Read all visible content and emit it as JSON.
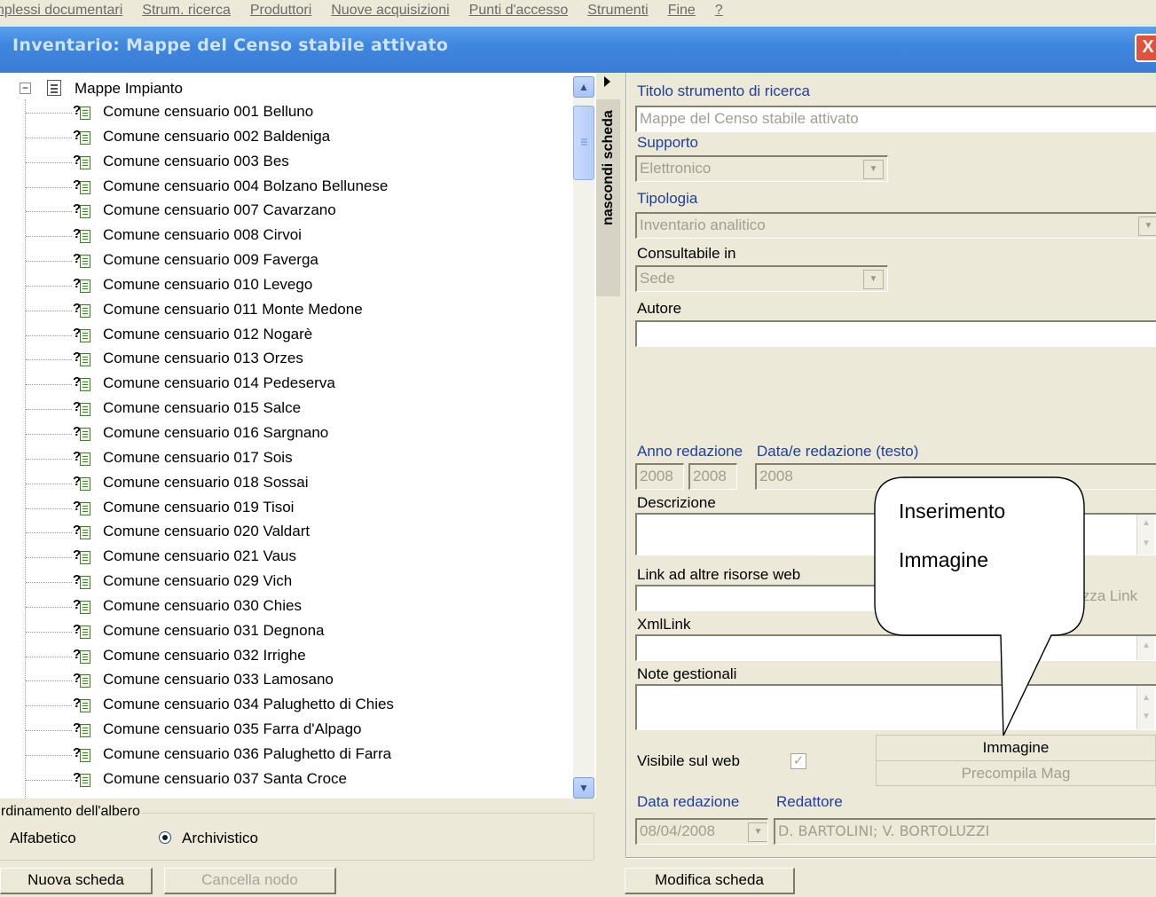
{
  "menubar": {
    "items": [
      "nplessi documentari",
      "Strum. ricerca",
      "Produttori",
      "Nuove acquisizioni",
      "Punti d'accesso",
      "Strumenti",
      "Fine",
      "?"
    ]
  },
  "window": {
    "title": "Inventario: Mappe del Censo stabile attivato",
    "close_label": "X"
  },
  "tree": {
    "root_label": "Mappe Impianto",
    "expander": "−",
    "items": [
      "Comune censuario 001 Belluno",
      "Comune censuario 002 Baldeniga",
      "Comune censuario 003 Bes",
      "Comune censuario 004 Bolzano Bellunese",
      "Comune censuario 007 Cavarzano",
      "Comune censuario 008 Cirvoi",
      "Comune censuario 009 Faverga",
      "Comune censuario 010 Levego",
      "Comune censuario 011 Monte Medone",
      "Comune censuario 012 Nogarè",
      "Comune censuario 013 Orzes",
      "Comune censuario 014 Pedeserva",
      "Comune censuario 015 Salce",
      "Comune censuario 016 Sargnano",
      "Comune censuario 017 Sois",
      "Comune censuario 018 Sossai",
      "Comune censuario 019 Tisoi",
      "Comune censuario 020 Valdart",
      "Comune censuario 021 Vaus",
      "Comune censuario 029 Vich",
      "Comune censuario 030 Chies",
      "Comune censuario 031 Degnona",
      "Comune censuario 032 Irrighe",
      "Comune censuario 033 Lamosano",
      "Comune censuario 034 Palughetto di Chies",
      "Comune censuario 035 Farra d'Alpago",
      "Comune censuario 036 Palughetto di Farra",
      "Comune censuario 037 Santa Croce"
    ],
    "node_icon": "question-document-icon"
  },
  "splitter": {
    "label": "nascondi scheda"
  },
  "ordering": {
    "legend": "rdinamento dell'albero",
    "option_alpha": "Alfabetico",
    "option_archive": "Archivistico",
    "selected": "Archivistico"
  },
  "buttons": {
    "new_card": "Nuova scheda",
    "delete_node": "Cancella nodo",
    "edit_card": "Modifica scheda",
    "image": "Immagine",
    "precompile_mag": "Precompila Mag",
    "view_link": "izza Link"
  },
  "form": {
    "titolo_label": "Titolo strumento di ricerca",
    "titolo_value": "Mappe del Censo stabile attivato",
    "supporto_label": "Supporto",
    "supporto_value": "Elettronico",
    "tipologia_label": "Tipologia",
    "tipologia_value": "Inventario analitico",
    "consultabile_label": "Consultabile in",
    "consultabile_value": "Sede",
    "autore_label": "Autore",
    "autore_value": "",
    "anno_label": "Anno redazione",
    "anno_from": "2008",
    "anno_to": "2008",
    "data_testo_label": "Data/e redazione (testo)",
    "data_testo_value": "2008",
    "descrizione_label": "Descrizione",
    "link_label": "Link ad altre risorse web",
    "xmllink_label": "XmlLink",
    "note_label": "Note gestionali",
    "visibile_label": "Visibile sul web",
    "visibile_checked": true,
    "check_mark": "✓",
    "data_redazione_label": "Data redazione",
    "data_redazione_value": "08/04/2008",
    "redattore_label": "Redattore",
    "redattore_value": "D. BARTOLINI; V. BORTOLUZZI"
  },
  "callout": {
    "line1": "Inserimento",
    "line2": "Immagine"
  },
  "colors": {
    "titlebar": "#3a7cd6",
    "label_blue": "#1f3f99",
    "window_bg": "#ece9d8"
  }
}
